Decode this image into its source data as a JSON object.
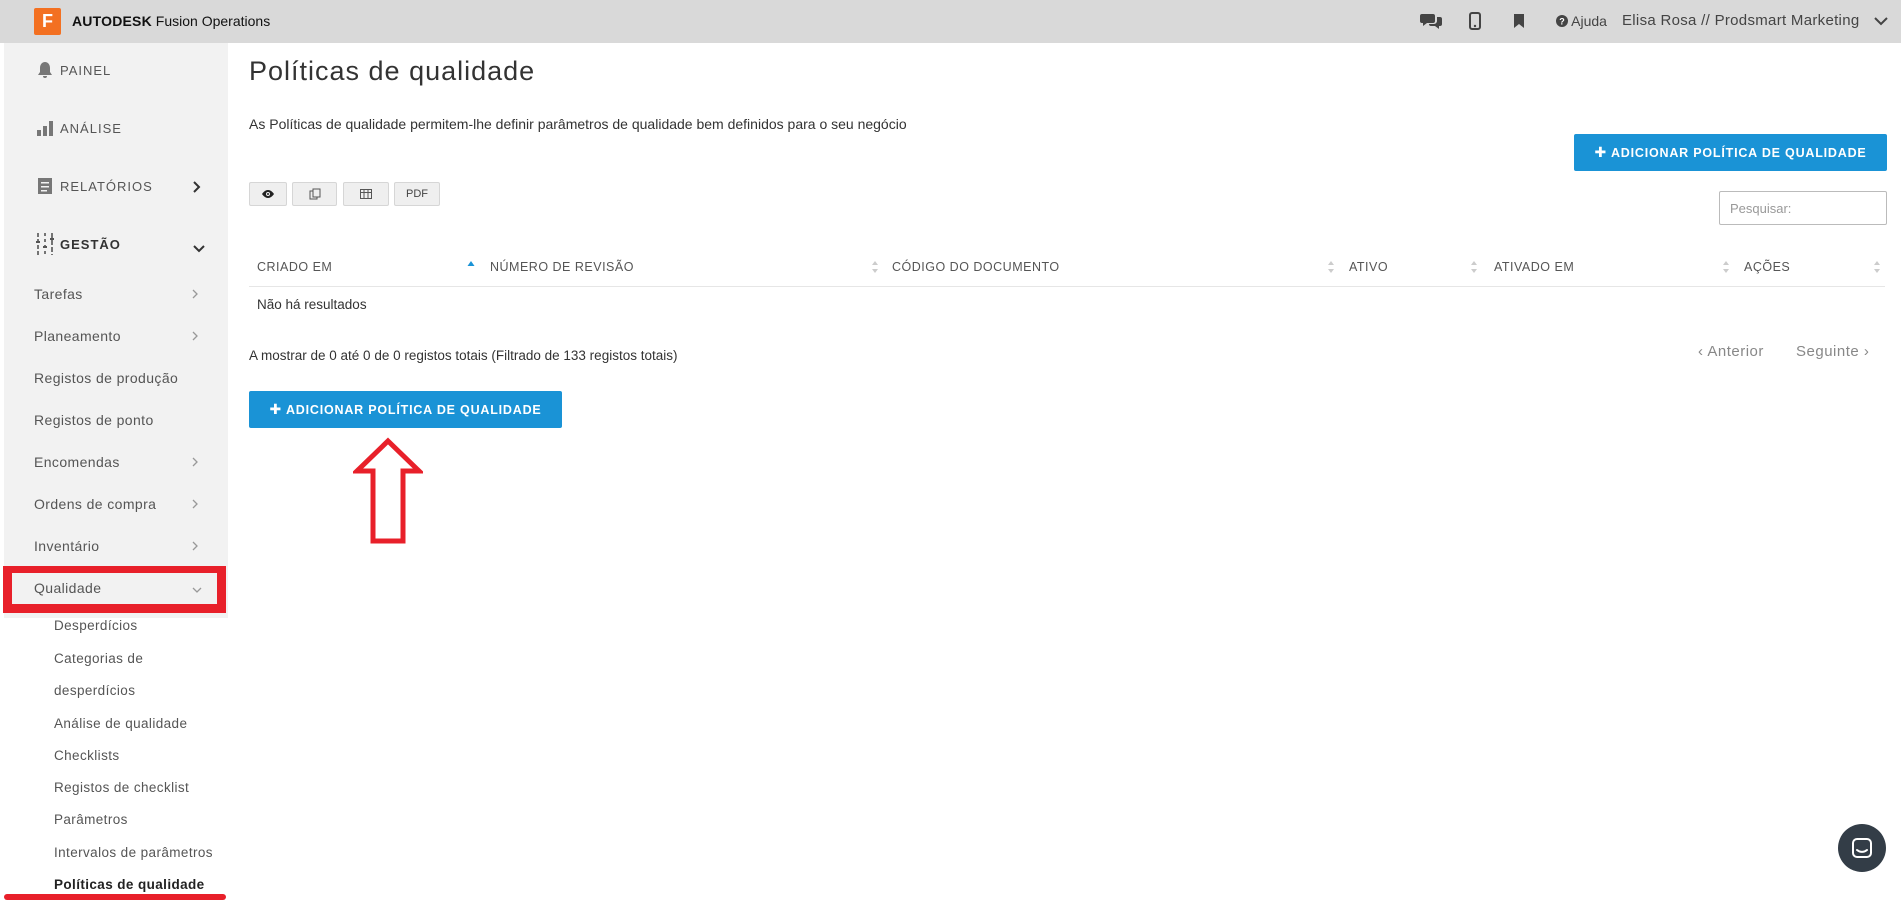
{
  "topbar": {
    "logo_letter": "F",
    "brand_bold": "AUTODESK",
    "brand_rest": " Fusion Operations",
    "help_label": "Ajuda",
    "user_label": "Elisa Rosa // Prodsmart Marketing",
    "icons": [
      "chat-icon",
      "mobile-icon",
      "bookmark-icon",
      "help-icon",
      "chevron-down-icon"
    ]
  },
  "sidebar": {
    "main": {
      "painel": "PAINEL",
      "analise": "ANÁLISE",
      "relatorios": "RELATÓRIOS",
      "gestao": "GESTÃO"
    },
    "items": [
      {
        "label": "Tarefas",
        "has_chevron": true
      },
      {
        "label": "Planeamento",
        "has_chevron": true
      },
      {
        "label": "Registos de produção",
        "has_chevron": false
      },
      {
        "label": "Registos de ponto",
        "has_chevron": false
      },
      {
        "label": "Encomendas",
        "has_chevron": true
      },
      {
        "label": "Ordens de compra",
        "has_chevron": true
      },
      {
        "label": "Inventário",
        "has_chevron": true
      },
      {
        "label": "Qualidade",
        "has_chevron": true
      }
    ],
    "quality_items": [
      "Desperdícios",
      "Categorias de",
      "desperdícios",
      "Análise de qualidade",
      "Checklists",
      "Registos de checklist",
      "Parâmetros",
      "Intervalos de parâmetros",
      "Políticas de qualidade"
    ],
    "active_item": "Políticas de qualidade"
  },
  "main": {
    "title": "Políticas de qualidade",
    "description": "As Políticas de qualidade permitem-lhe definir parâmetros de qualidade bem definidos para o seu negócio",
    "add_button_label": "ADICIONAR POLÍTICA DE QUALIDADE",
    "toolbar": {
      "pdf_label": "PDF"
    },
    "search_placeholder": "Pesquisar:",
    "table": {
      "columns": [
        "CRIADO EM",
        "NÚMERO DE REVISÃO",
        "CÓDIGO DO DOCUMENTO",
        "ATIVO",
        "ATIVADO EM",
        "AÇÕES"
      ],
      "empty_text": "Não há resultados"
    },
    "info_text": "A mostrar de 0 até 0 de 0 registos totais (Filtrado de 133 registos totais)",
    "pager": {
      "prev": "Anterior",
      "next": "Seguinte"
    }
  },
  "colors": {
    "accent_blue": "#1a93d6",
    "annotation_red": "#e8202a",
    "logo_orange": "#f37021",
    "topbar_gray": "#d9d9d9"
  }
}
